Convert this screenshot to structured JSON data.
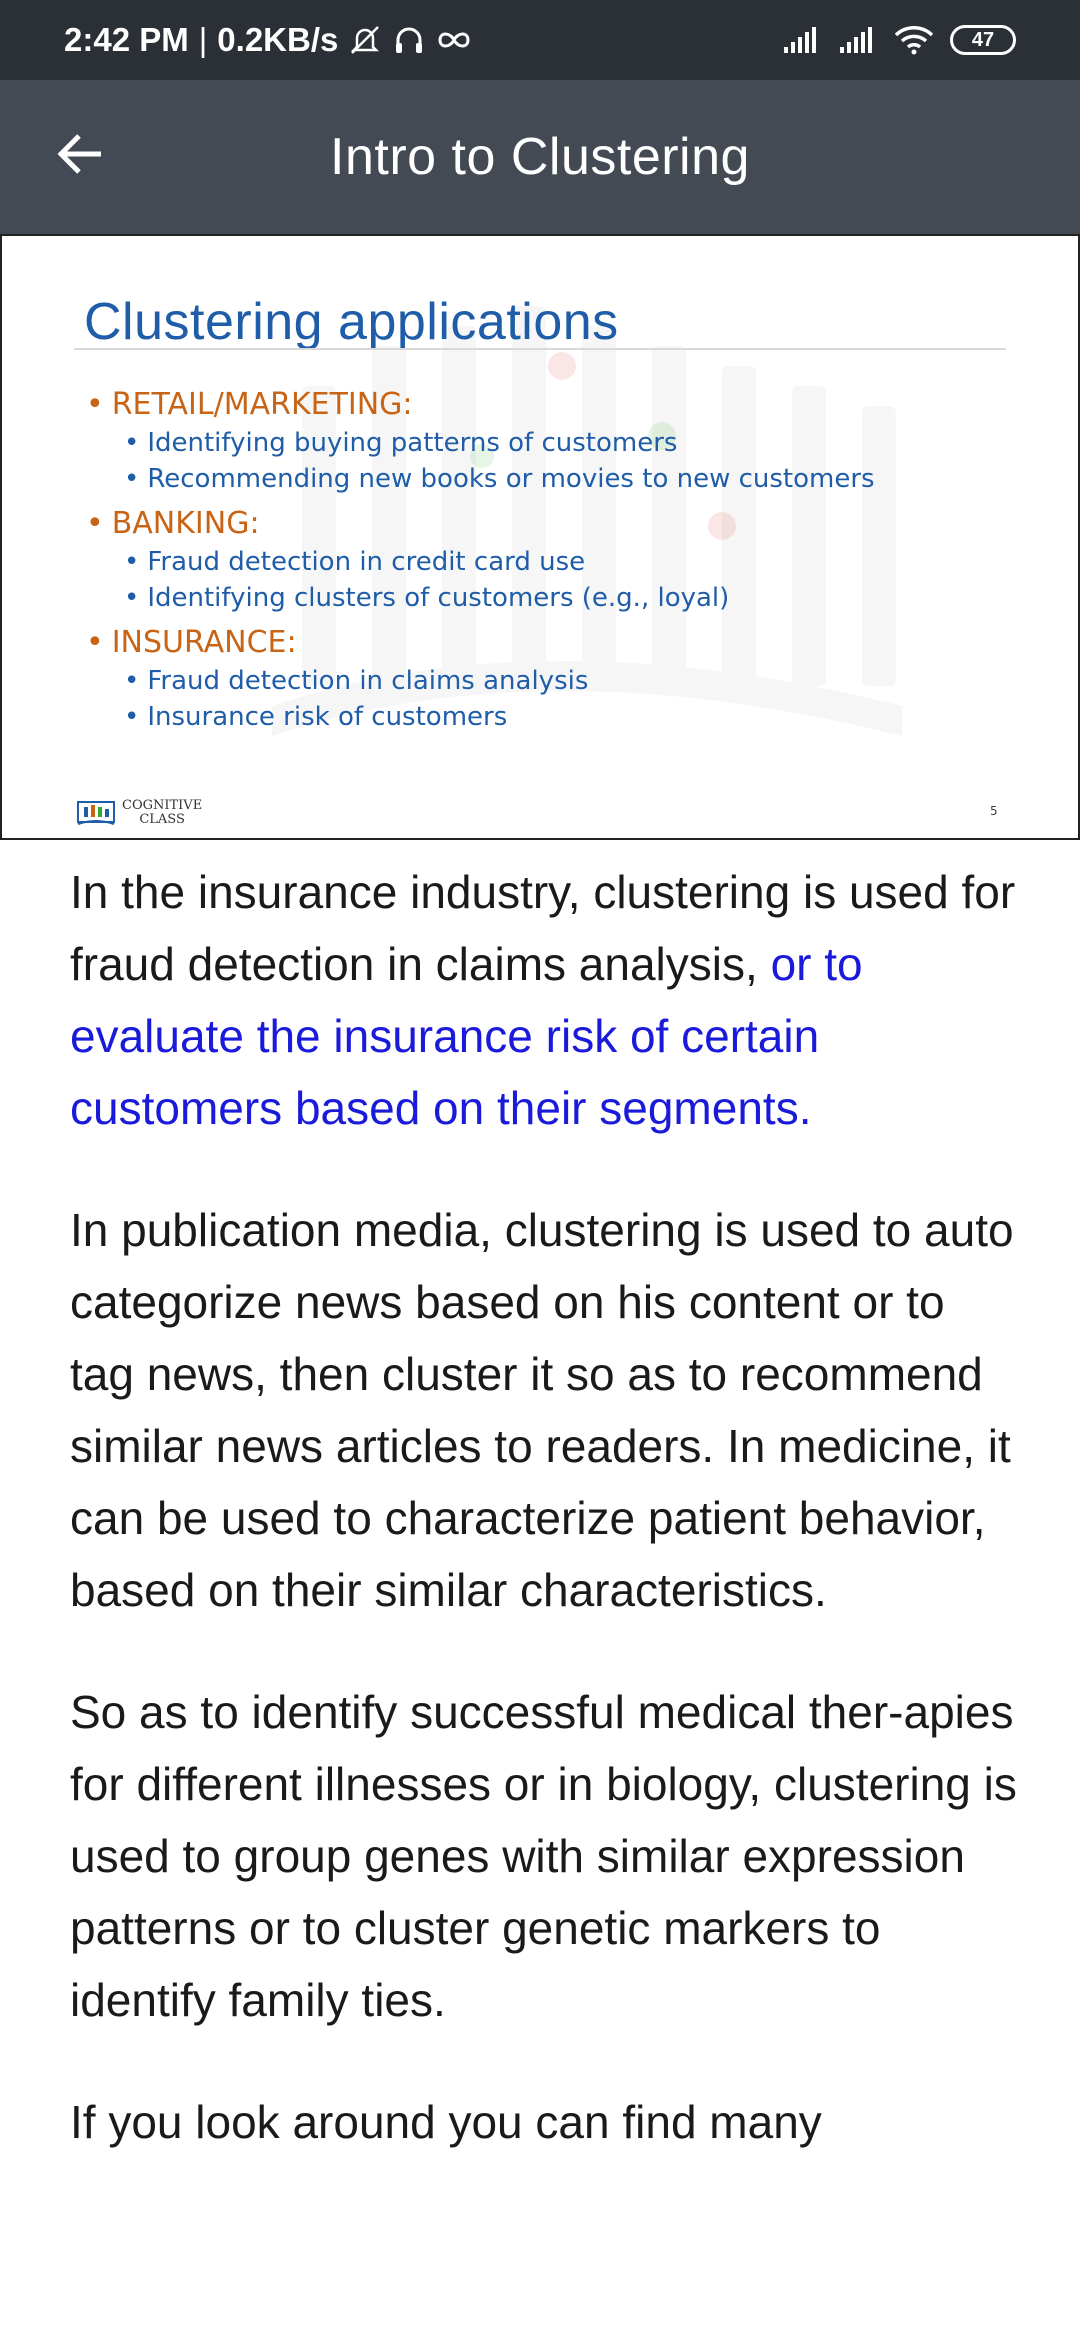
{
  "status_bar": {
    "time": "2:42 PM",
    "separator": "|",
    "speed": "0.2KB/s",
    "battery": "47",
    "icons": [
      "mute-icon",
      "headphones-icon",
      "infinity-icon",
      "signal-icon",
      "signal-icon",
      "wifi-icon",
      "battery-icon"
    ]
  },
  "app_bar": {
    "title": "Intro to Clustering",
    "back_icon": "back-arrow-icon"
  },
  "slide": {
    "title": "Clustering applications",
    "categories": [
      {
        "label": "RETAIL/MARKETING:",
        "items": [
          "Identifying buying patterns of customers",
          "Recommending new books or movies to new customers"
        ]
      },
      {
        "label": "BANKING:",
        "items": [
          "Fraud detection in credit card use",
          "Identifying clusters of customers (e.g., loyal)"
        ]
      },
      {
        "label": "INSURANCE:",
        "items": [
          "Fraud detection in claims analysis",
          "Insurance risk of customers"
        ]
      }
    ],
    "logo_line1": "COGNITIVE",
    "logo_line2": "CLASS",
    "page_number": "5",
    "colors": {
      "title": "#1f5da8",
      "category": "#c86416",
      "item": "#1f5da8"
    }
  },
  "content": {
    "p1_plain": "In the insurance industry, clustering is used for fraud detection in claims analysis, ",
    "p1_highlight": "or to evaluate the insurance risk of certain customers based on their segments.",
    "p2": "In publication media, clustering is used to auto categorize news based on his content or to tag news, then cluster it so as to recommend similar news articles to readers. In medicine, it can be used to characterize patient behavior, based on their similar characteristics.",
    "p3": "So as to identify successful medical ther-apies for different illnesses or in biology, clustering is used to group genes with similar expression patterns or to cluster genetic markers to identify family ties.",
    "p4": "If you look around you can find many",
    "highlight_color": "#1a1adb"
  }
}
